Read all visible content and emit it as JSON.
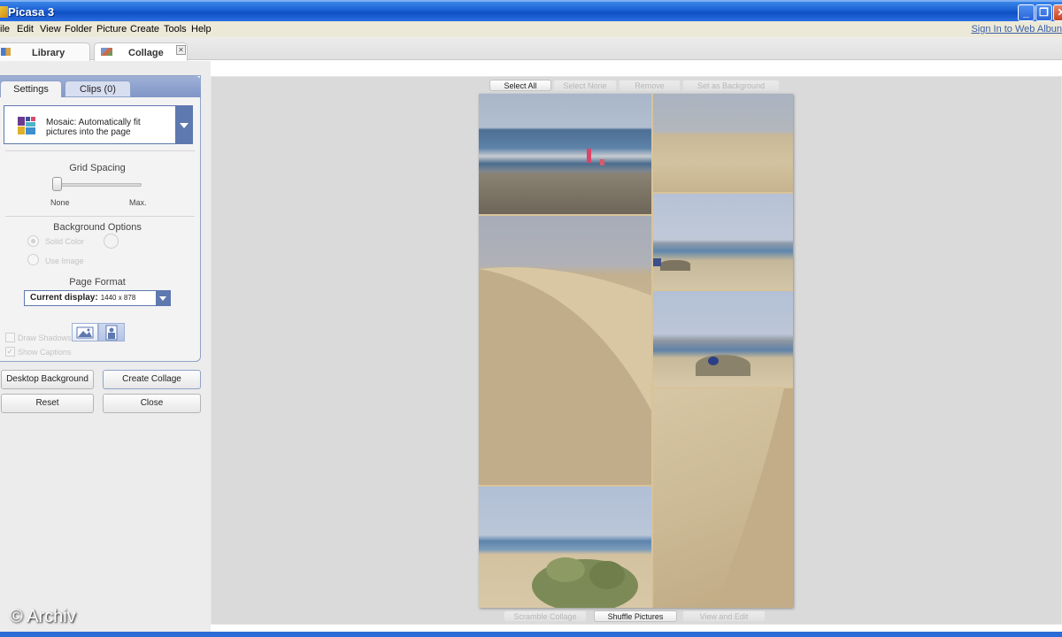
{
  "window": {
    "title": "Picasa 3"
  },
  "menu": {
    "items": [
      "ile",
      "Edit",
      "View",
      "Folder",
      "Picture",
      "Create",
      "Tools",
      "Help"
    ],
    "signin": "Sign In to Web Albun"
  },
  "top_tabs": {
    "library": "Library",
    "collage": "Collage",
    "close_glyph": "✕"
  },
  "panel": {
    "tabs": {
      "settings": "Settings",
      "clips": "Clips (0)"
    },
    "layout": {
      "text": "Mosaic:  Automatically fit pictures into the page"
    },
    "grid_spacing": {
      "title": "Grid Spacing",
      "min_label": "None",
      "max_label": "Max.",
      "level": 0.0
    },
    "background": {
      "title": "Background Options",
      "solid_color": "Solid Color",
      "use_image": "Use Image"
    },
    "page_format": {
      "title": "Page Format",
      "label": "Current display:",
      "value": "1440 x 878"
    },
    "checkboxes": {
      "draw_shadows": "Draw Shadows",
      "show_captions": "Show Captions"
    },
    "buttons": {
      "desktop_background": "Desktop Background",
      "create_collage": "Create Collage",
      "reset": "Reset",
      "close": "Close"
    }
  },
  "canvas_top": {
    "select_all": "Select All",
    "select_none": "Select None",
    "remove": "Remove",
    "set_as_background": "Set as Background"
  },
  "canvas_bottom": {
    "scramble": "Scramble Collage",
    "shuffle": "Shuffle Pictures",
    "view_edit": "View and Edit"
  },
  "watermark": "© Archiv",
  "colors": {
    "accent": "#5e78b0",
    "titlebar": "#1a5fd2",
    "canvas": "#dadada"
  }
}
